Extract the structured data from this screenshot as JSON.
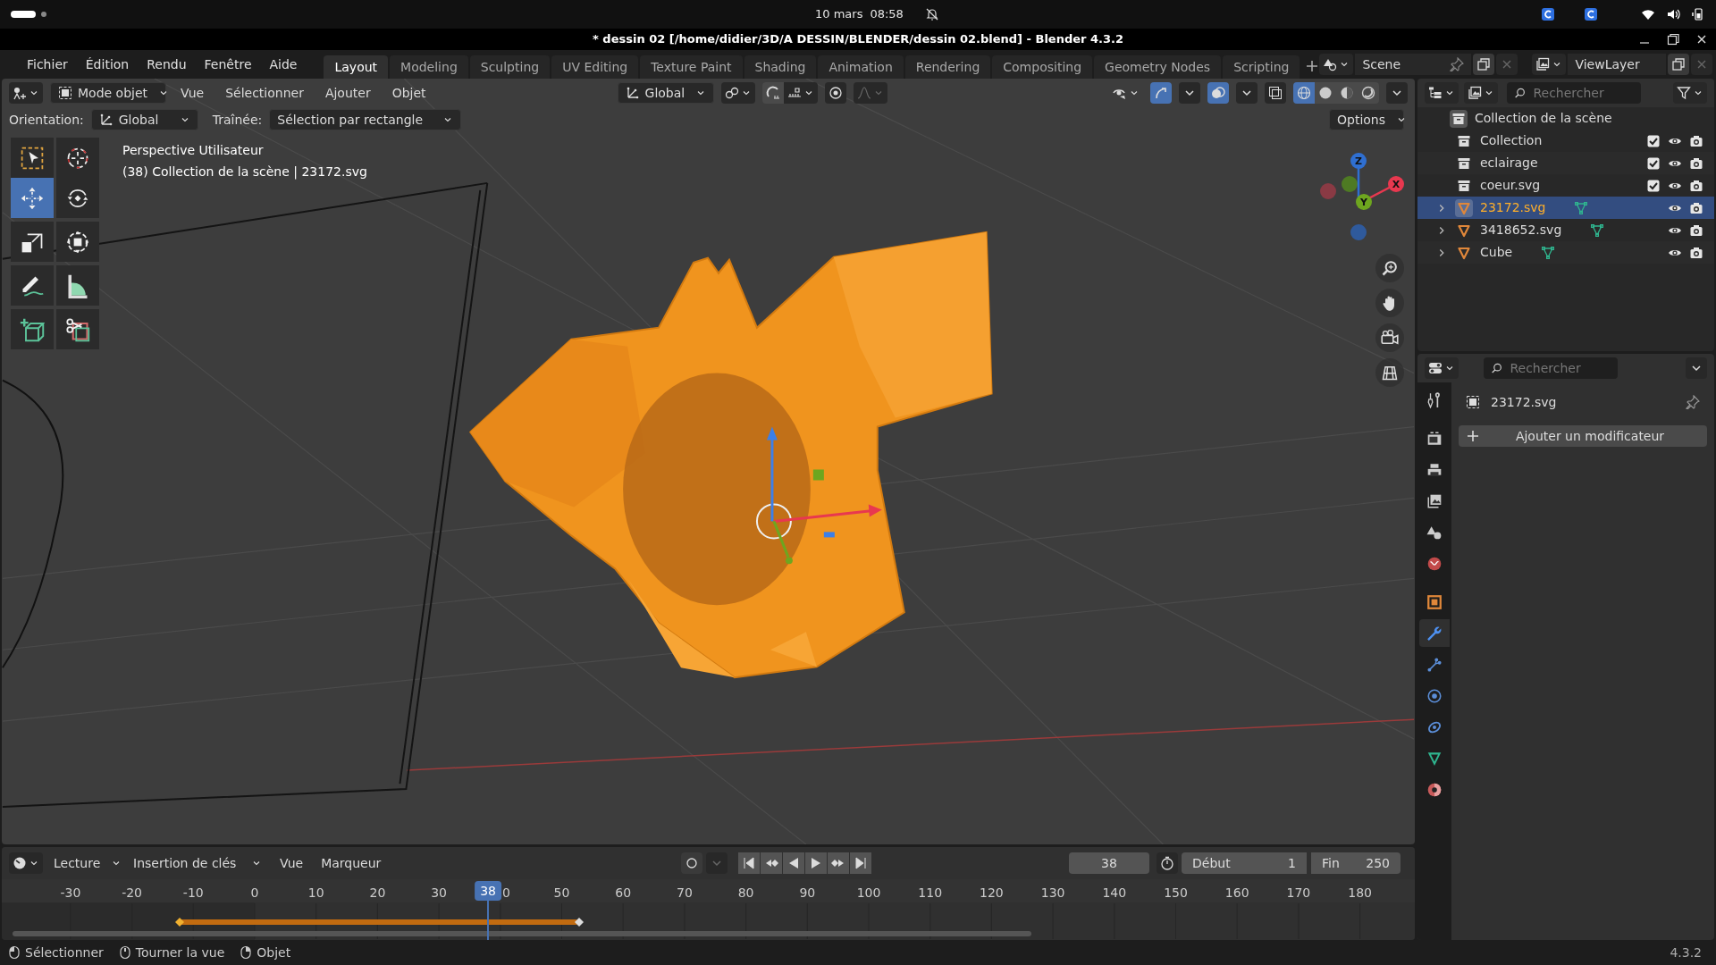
{
  "system_bar": {
    "date": "10 mars",
    "time": "08:58"
  },
  "window": {
    "title": "* dessin 02 [/home/didier/3D/A DESSIN/BLENDER/dessin 02.blend] - Blender 4.3.2"
  },
  "menu": [
    "Fichier",
    "Édition",
    "Rendu",
    "Fenêtre",
    "Aide"
  ],
  "workspaces": [
    {
      "label": "Layout",
      "selected": true
    },
    {
      "label": "Modeling",
      "selected": false
    },
    {
      "label": "Sculpting",
      "selected": false
    },
    {
      "label": "UV Editing",
      "selected": false
    },
    {
      "label": "Texture Paint",
      "selected": false
    },
    {
      "label": "Shading",
      "selected": false
    },
    {
      "label": "Animation",
      "selected": false
    },
    {
      "label": "Rendering",
      "selected": false
    },
    {
      "label": "Compositing",
      "selected": false
    },
    {
      "label": "Geometry Nodes",
      "selected": false
    },
    {
      "label": "Scripting",
      "selected": false
    }
  ],
  "scene": "Scene",
  "view_layer": "ViewLayer",
  "viewport_header": {
    "mode": "Mode objet",
    "menus": [
      "Vue",
      "Sélectionner",
      "Ajouter",
      "Objet"
    ],
    "transform": "Global"
  },
  "tool_settings": {
    "orientation_label": "Orientation:",
    "orientation": "Global",
    "drag_label": "Traînée:",
    "drag": "Sélection par rectangle",
    "options": "Options"
  },
  "tools": [
    {
      "kind": "select",
      "selected": false
    },
    {
      "kind": "cursor",
      "selected": false
    },
    {
      "kind": "move",
      "selected": true
    },
    {
      "kind": "rotate",
      "selected": false
    },
    {
      "kind": "scale",
      "selected": false
    },
    {
      "kind": "transform",
      "selected": false
    },
    {
      "kind": "annotate",
      "selected": false
    },
    {
      "kind": "measure",
      "selected": false
    },
    {
      "kind": "addcube",
      "selected": false
    },
    {
      "kind": "cut",
      "selected": false
    }
  ],
  "viewport_overlay": {
    "view_name": "Perspective Utilisateur",
    "context": "(38) Collection de la scène | 23172.svg"
  },
  "gizmo": [
    {
      "label": "Z",
      "color": "#2f6fd1"
    },
    {
      "label": "X",
      "color": "#e8384f"
    },
    {
      "label": "Y",
      "color": "#6ea61f"
    }
  ],
  "outliner": {
    "search_placeholder": "Rechercher",
    "root": {
      "name": "Collection de la scène",
      "children": [
        {
          "kind": "collection",
          "name": "Collection",
          "checked": true,
          "selected": false
        },
        {
          "kind": "collection",
          "name": "eclairage",
          "checked": true,
          "selected": false
        },
        {
          "kind": "collection",
          "name": "coeur.svg",
          "checked": true,
          "selected": false
        },
        {
          "kind": "mesh",
          "name": "23172.svg",
          "selected": true
        },
        {
          "kind": "mesh",
          "name": "3418652.svg",
          "selected": false
        },
        {
          "kind": "mesh",
          "name": "Cube",
          "selected": false
        }
      ]
    }
  },
  "properties": {
    "search_placeholder": "Rechercher",
    "object_name": "23172.svg",
    "add_modifier": "Ajouter un modificateur",
    "tabs": [
      {
        "kind": "tool",
        "selected": false
      },
      {
        "kind": "render",
        "selected": false
      },
      {
        "kind": "output",
        "selected": false
      },
      {
        "kind": "viewlayer",
        "selected": false
      },
      {
        "kind": "scene",
        "selected": false
      },
      {
        "kind": "world",
        "selected": false
      },
      {
        "kind": "object",
        "selected": false
      },
      {
        "kind": "modifiers",
        "selected": true
      },
      {
        "kind": "particles",
        "selected": false
      },
      {
        "kind": "physics",
        "selected": false
      },
      {
        "kind": "constraints",
        "selected": false
      },
      {
        "kind": "data",
        "selected": false
      },
      {
        "kind": "material",
        "selected": false
      }
    ]
  },
  "timeline": {
    "menus": [
      "Lecture",
      "Insertion de clés",
      "Vue",
      "Marqueur"
    ],
    "current_frame": "38",
    "start_label": "Début",
    "start": "1",
    "end_label": "Fin",
    "end": "250",
    "playhead": "38",
    "ticks": [
      "-30",
      "-20",
      "-10",
      "0",
      "10",
      "20",
      "30",
      "0",
      "50",
      "60",
      "70",
      "80",
      "90",
      "100",
      "110",
      "120",
      "130",
      "140",
      "150",
      "160",
      "170",
      "180"
    ]
  },
  "status_bar": {
    "hints": [
      {
        "kind": "left",
        "label": "Sélectionner"
      },
      {
        "kind": "middle",
        "label": "Tourner la vue"
      },
      {
        "kind": "right",
        "label": "Objet"
      }
    ],
    "version": "4.3.2"
  }
}
